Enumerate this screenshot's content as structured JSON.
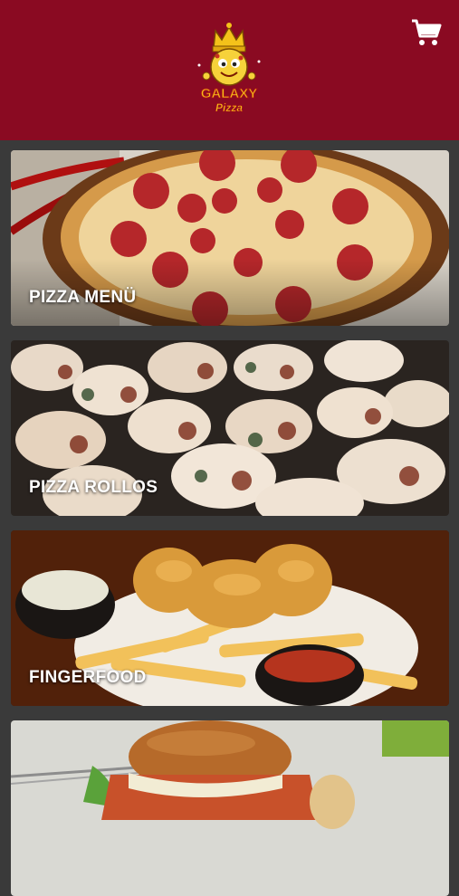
{
  "header": {
    "brand_line1": "GALAXY",
    "brand_line2": "Pizza",
    "background_color": "#8a0a22",
    "cart_icon": "shopping-cart-icon"
  },
  "menu": {
    "categories": [
      {
        "label": "PIZZA MENÜ",
        "image": "pepperoni-pizza"
      },
      {
        "label": "PIZZA ROLLOS",
        "image": "pizza-rolls"
      },
      {
        "label": "FINGERFOOD",
        "image": "fried-fish-and-fries"
      },
      {
        "label": "",
        "image": "burger"
      }
    ]
  }
}
